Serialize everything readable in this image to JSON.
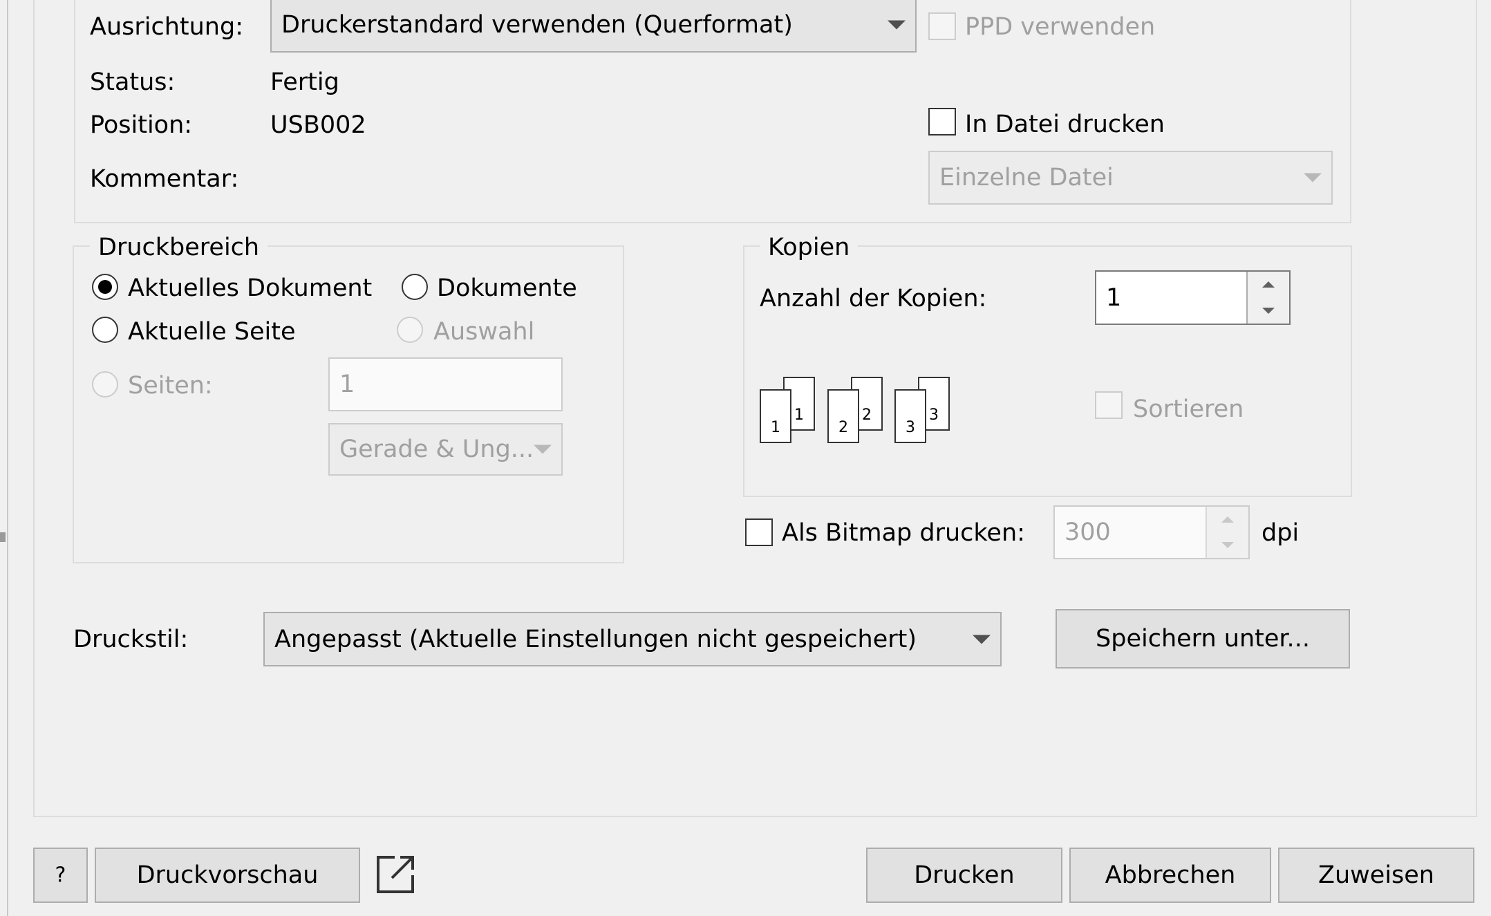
{
  "printer_info": {
    "orientation_label": "Ausrichtung:",
    "orientation_value": "Druckerstandard verwenden (Querformat)",
    "ppd_label": "PPD verwenden",
    "status_label": "Status:",
    "status_value": "Fertig",
    "position_label": "Position:",
    "position_value": "USB002",
    "print_to_file_label": "In Datei drucken",
    "file_mode_value": "Einzelne Datei",
    "comment_label": "Kommentar:"
  },
  "print_range": {
    "legend": "Druckbereich",
    "current_document": "Aktuelles Dokument",
    "documents": "Dokumente",
    "current_page": "Aktuelle Seite",
    "selection": "Auswahl",
    "pages_label": "Seiten:",
    "pages_value": "1",
    "parity_value": "Gerade & Ung..."
  },
  "copies": {
    "legend": "Kopien",
    "count_label": "Anzahl der Kopien:",
    "count_value": "1",
    "collate_label": "Sortieren",
    "pages": [
      "1",
      "1",
      "2",
      "2",
      "3",
      "3"
    ]
  },
  "bitmap": {
    "label": "Als Bitmap drucken:",
    "dpi_value": "300",
    "unit": "dpi"
  },
  "print_style": {
    "label": "Druckstil:",
    "value": "Angepasst (Aktuelle Einstellungen nicht gespeichert)",
    "save_as_button": "Speichern unter..."
  },
  "footer": {
    "help_button": "?",
    "preview_button": "Druckvorschau",
    "print_button": "Drucken",
    "cancel_button": "Abbrechen",
    "apply_button": "Zuweisen"
  }
}
